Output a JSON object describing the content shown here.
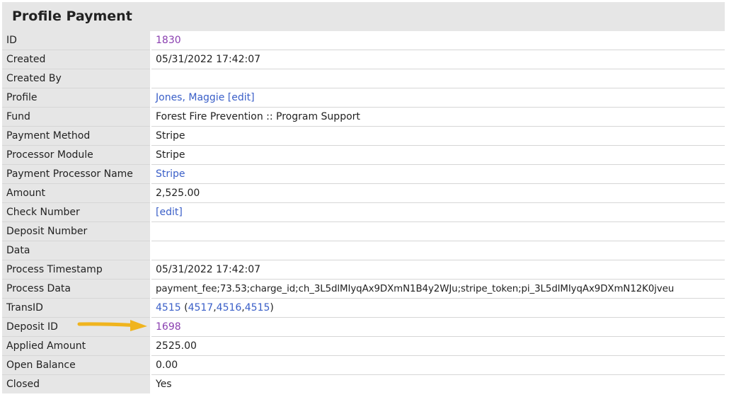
{
  "panel": {
    "title": "Profile Payment"
  },
  "rows": {
    "id": {
      "label": "ID",
      "value": "1830"
    },
    "created": {
      "label": "Created",
      "value": "05/31/2022 17:42:07"
    },
    "created_by": {
      "label": "Created By",
      "value": ""
    },
    "profile": {
      "label": "Profile",
      "value": "Jones, Maggie",
      "edit": "[edit]"
    },
    "fund": {
      "label": "Fund",
      "value": "Forest Fire Prevention :: Program Support"
    },
    "payment_method": {
      "label": "Payment Method",
      "value": "Stripe"
    },
    "processor_module": {
      "label": "Processor Module",
      "value": "Stripe"
    },
    "payment_processor_name": {
      "label": "Payment Processor Name",
      "value": "Stripe"
    },
    "amount": {
      "label": "Amount",
      "value": "2,525.00"
    },
    "check_number": {
      "label": "Check Number",
      "edit": "[edit]"
    },
    "deposit_number": {
      "label": "Deposit Number",
      "value": ""
    },
    "data": {
      "label": "Data",
      "value": ""
    },
    "process_timestamp": {
      "label": "Process Timestamp",
      "value": "05/31/2022 17:42:07"
    },
    "process_data": {
      "label": "Process Data",
      "value": "payment_fee;73.53;charge_id;ch_3L5dlMIyqAx9DXmN1B4y2WJu;stripe_token;pi_3L5dlMIyqAx9DXmN12K0jveu"
    },
    "trans_id": {
      "label": "TransID",
      "value": "4515",
      "open_paren": "(",
      "related": [
        "4517",
        "4516",
        "4515"
      ],
      "sep": ",",
      "close_paren": ")"
    },
    "deposit_id": {
      "label": "Deposit ID",
      "value": "1698"
    },
    "applied_amount": {
      "label": "Applied Amount",
      "value": "2525.00"
    },
    "open_balance": {
      "label": "Open Balance",
      "value": "0.00"
    },
    "closed": {
      "label": "Closed",
      "value": "Yes"
    }
  },
  "annotation": {
    "arrow_color": "#f0b41e",
    "icon": "arrow-right-icon"
  },
  "colors": {
    "link_purple": "#8a3fb0",
    "link_blue": "#3a5fc8",
    "label_bg": "#e6e6e6"
  }
}
